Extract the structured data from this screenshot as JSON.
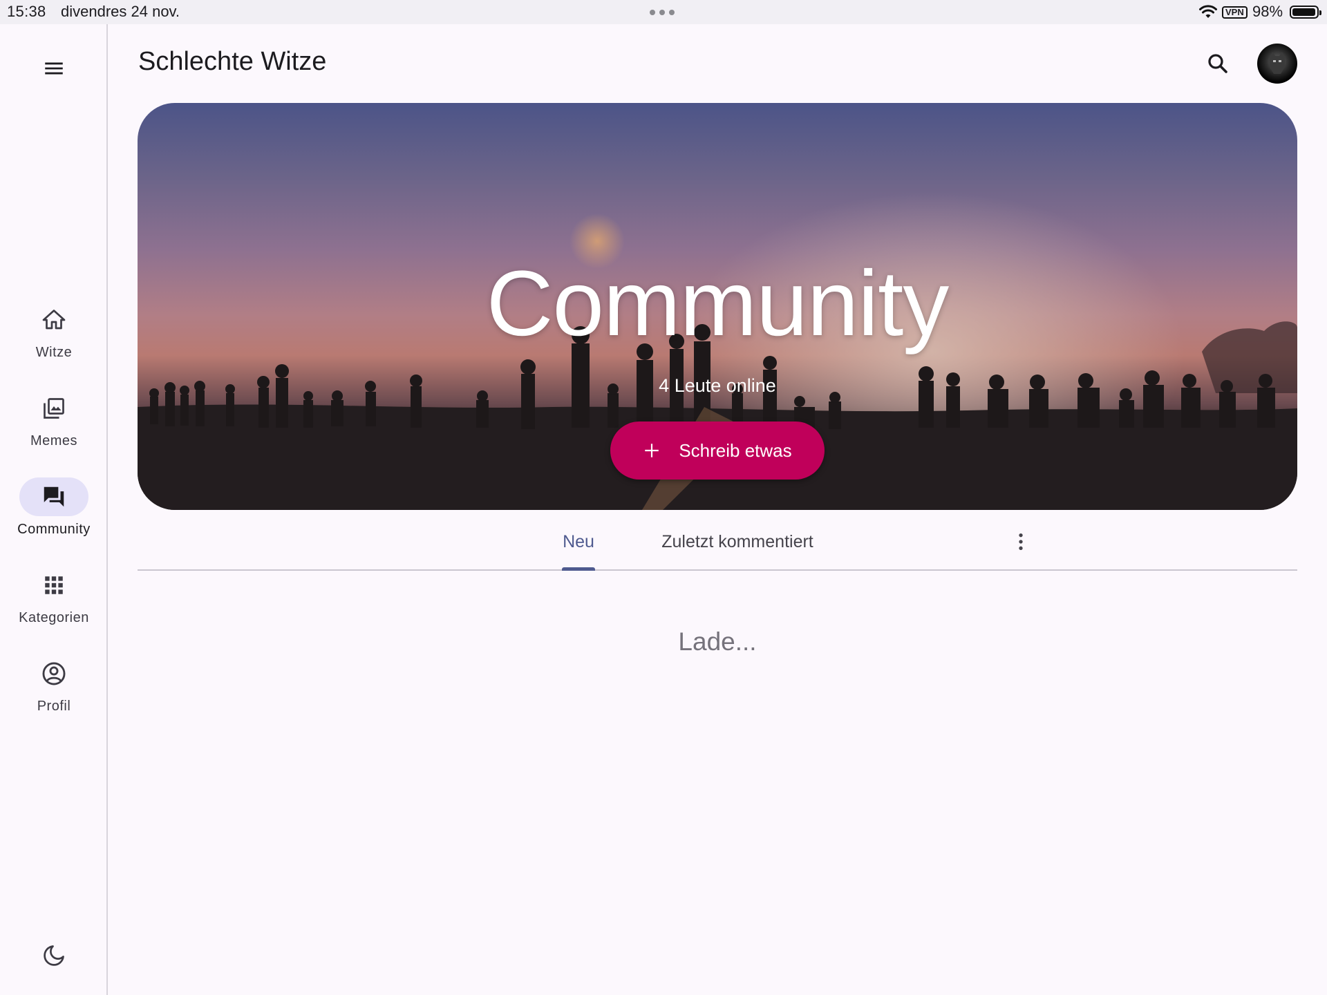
{
  "status_bar": {
    "time": "15:38",
    "date": "divendres 24 nov.",
    "vpn": "VPN",
    "battery_percent": "98%",
    "battery_level": 0.98,
    "wifi_icon": "wifi-icon",
    "more_icon": "more-horiz-icon"
  },
  "rail": {
    "menu_icon": "menu-icon",
    "items": [
      {
        "label": "Witze",
        "icon": "home-icon",
        "active": false
      },
      {
        "label": "Memes",
        "icon": "photo-library-icon",
        "active": false
      },
      {
        "label": "Community",
        "icon": "forum-icon",
        "active": true
      },
      {
        "label": "Kategorien",
        "icon": "apps-grid-icon",
        "active": false
      },
      {
        "label": "Profil",
        "icon": "account-circle-icon",
        "active": false
      }
    ],
    "theme_icon": "dark-mode-moon-icon"
  },
  "app_bar": {
    "title": "Schlechte Witze",
    "search_icon": "search-icon",
    "avatar": "user-avatar"
  },
  "hero": {
    "title": "Community",
    "subtitle": "4 Leute online",
    "fab_label": "Schreib etwas",
    "fab_icon": "plus-icon"
  },
  "tabs": {
    "items": [
      {
        "label": "Neu",
        "active": true
      },
      {
        "label": "Zuletzt kommentiert",
        "active": false
      }
    ],
    "more_icon": "more-vert-icon"
  },
  "content": {
    "loading_text": "Lade..."
  },
  "colors": {
    "background": "#fcf8fd",
    "accent": "#4f5a8f",
    "fab": "#c0005a",
    "active_pill": "#e4e1f8"
  }
}
